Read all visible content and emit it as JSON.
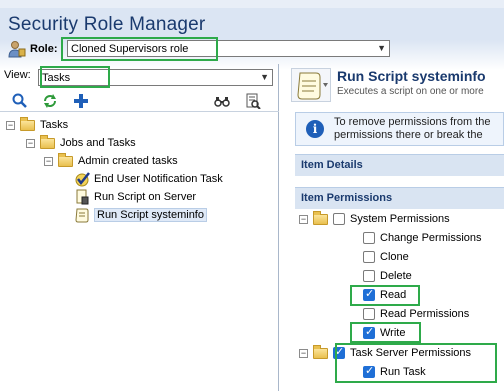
{
  "app": {
    "title": "Security Role Manager"
  },
  "role": {
    "label": "Role:",
    "value": "Cloned Supervisors role"
  },
  "view": {
    "label": "View:",
    "value": "Tasks"
  },
  "toolbar": {
    "icons": [
      "search-icon",
      "refresh-icon",
      "add-icon",
      "binoculars-icon",
      "find-in-page-icon"
    ]
  },
  "tree": {
    "root": "Tasks",
    "jobs": "Jobs and Tasks",
    "admin": "Admin created tasks",
    "items": [
      "End User Notification Task",
      "Run Script on Server",
      "Run Script systeminfo"
    ]
  },
  "detail": {
    "title": "Run Script systeminfo",
    "subtitle": "Executes a script on one or more",
    "info_line1": "To remove permissions from the",
    "info_line2": "permissions there or break the",
    "item_details": "Item Details",
    "item_permissions": "Item Permissions"
  },
  "permissions": {
    "system": {
      "label": "System Permissions",
      "checked": false,
      "items": [
        {
          "label": "Change Permissions",
          "checked": false
        },
        {
          "label": "Clone",
          "checked": false
        },
        {
          "label": "Delete",
          "checked": false
        },
        {
          "label": "Read",
          "checked": true
        },
        {
          "label": "Read Permissions",
          "checked": false
        },
        {
          "label": "Write",
          "checked": true
        }
      ]
    },
    "task_server": {
      "label": "Task Server Permissions",
      "checked": true,
      "items": [
        {
          "label": "Run Task",
          "checked": true
        }
      ]
    }
  },
  "colors": {
    "highlight": "#2eaa4a",
    "title": "#1a3a6e",
    "checkbox": "#1f6fd6"
  }
}
